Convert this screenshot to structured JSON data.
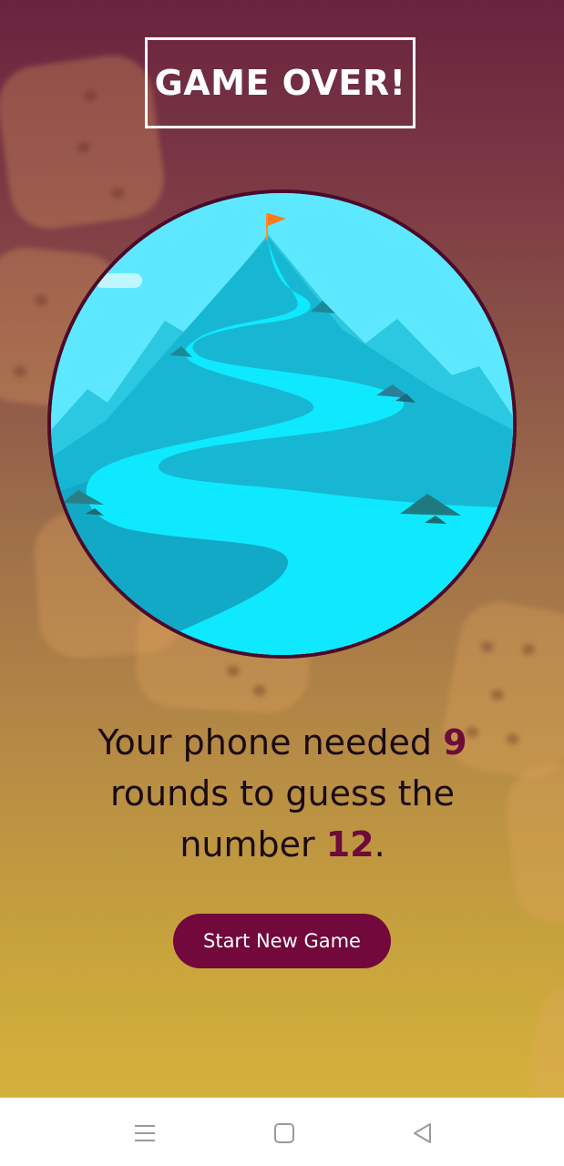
{
  "screen": {
    "title": "GAME OVER!",
    "summary": {
      "part1": "Your phone needed ",
      "rounds": "9",
      "part2": " rounds to guess the number ",
      "number": "12",
      "part3": "."
    },
    "start_button_label": "Start New Game"
  },
  "image": {
    "description_icon": "mountain-summit-illustration",
    "flag_icon": "flag-icon"
  },
  "navbar": {
    "menu_icon": "menu-icon",
    "home_icon": "home-icon",
    "back_icon": "back-icon"
  },
  "colors": {
    "accent": "#72083c",
    "highlight_text": "#6d0b3a",
    "circle_border": "#4a0a2a",
    "sky": "#5ee8ff",
    "gradient_top": "#69233f",
    "gradient_bottom": "#d4b13c"
  }
}
